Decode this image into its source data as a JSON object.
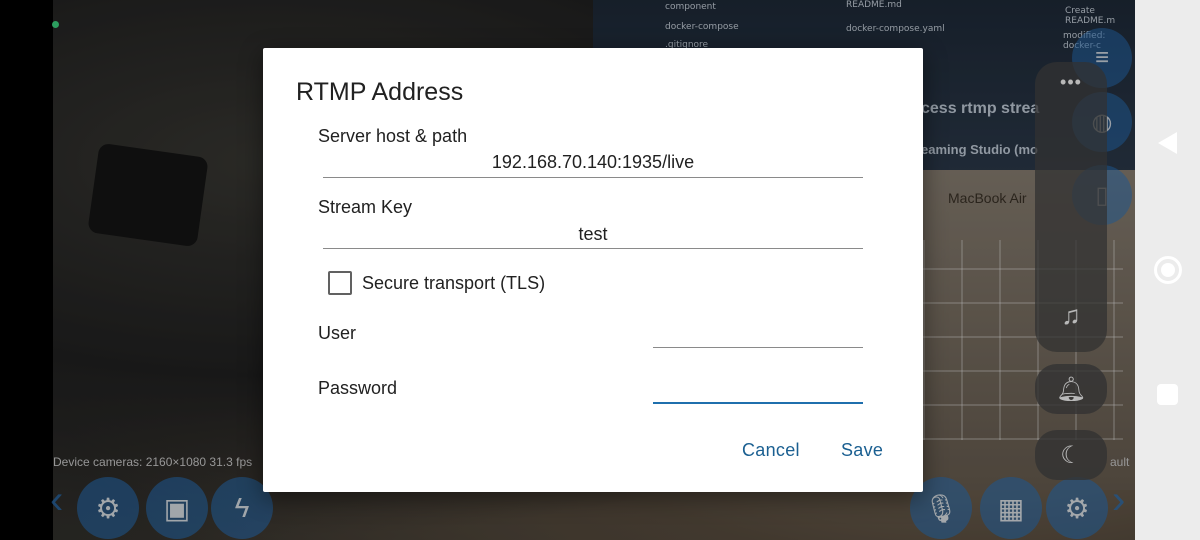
{
  "dialog": {
    "title": "RTMP Address",
    "server_label": "Server host & path",
    "server_value": "192.168.70.140:1935/live",
    "stream_key_label": "Stream Key",
    "stream_key_value": "test",
    "tls_label": "Secure transport (TLS)",
    "tls_checked": false,
    "user_label": "User",
    "user_value": "",
    "password_label": "Password",
    "password_value": "",
    "cancel_label": "Cancel",
    "save_label": "Save"
  },
  "camera": {
    "info": "Device cameras: 2160×1080  31.3 fps",
    "right_text": "ault",
    "background_texts": {
      "folder_component": "component",
      "folder_docker": "docker-compose",
      "folder_ignore": ".gitignore",
      "file_readme": "README.md",
      "file_compose": "docker-compose.yaml",
      "commit_msg": "Create README.m",
      "modified": "modified: docker-c",
      "headline": "cess rtmp strea",
      "subheadline": "eaming Studio (mo",
      "macbook": "MacBook Air"
    }
  },
  "side_panel": {
    "menu_icon": "ellipsis-icon",
    "music_icon": "music-off-icon",
    "bell_icon": "bell-icon",
    "moon_icon": "moon-icon"
  },
  "toolbar": {
    "settings_icon": "gear-icon",
    "camera_switch_icon": "camera-switch-icon",
    "flash_icon": "flash-icon",
    "mic_icon": "mic-off-icon",
    "overlay_icon": "image-overlay-icon"
  },
  "colors": {
    "accent": "#1a5f91",
    "focus_underline": "#1f6fad",
    "status_dot": "#3ddc84"
  }
}
